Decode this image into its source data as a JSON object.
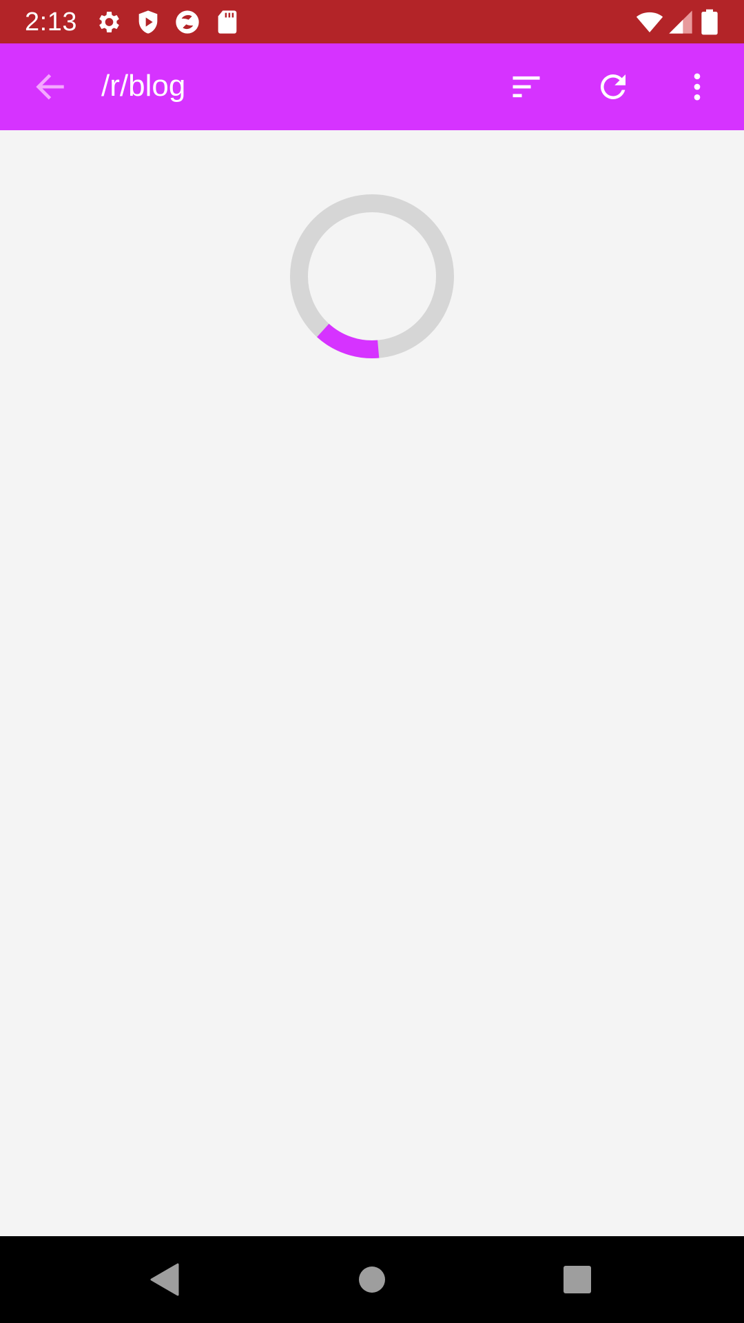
{
  "status_bar": {
    "time": "2:13",
    "background": "#b32428",
    "left_icons": [
      "settings-icon",
      "shield-play-icon",
      "camera-app-icon",
      "sd-card-icon"
    ],
    "right_icons": [
      "wifi-icon",
      "signal-icon",
      "battery-icon"
    ]
  },
  "app_bar": {
    "title": "/r/blog",
    "background": "#d633ff",
    "actions": [
      "sort-icon",
      "refresh-icon",
      "more-vert-icon"
    ]
  },
  "loading": {
    "indicator": "circular-progress",
    "track_color": "#d6d6d6",
    "accent_color": "#d633ff"
  },
  "nav_bar": {
    "buttons": [
      "back-triangle-icon",
      "home-circle-icon",
      "recents-square-icon"
    ]
  }
}
